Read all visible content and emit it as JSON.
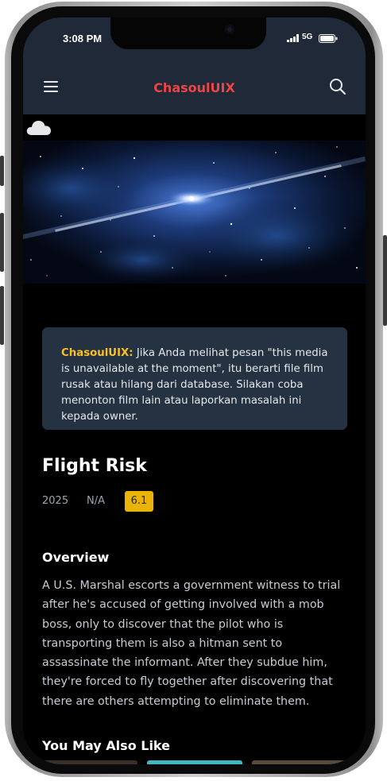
{
  "status_bar": {
    "time": "3:08 PM",
    "network": "5G",
    "icons": [
      "signal-icon",
      "battery-icon"
    ]
  },
  "header": {
    "brand": "ChasoulUIX",
    "brand_color": "#ef4444",
    "icons": [
      "hamburger-menu-icon",
      "search-icon"
    ]
  },
  "notice": {
    "brand": "ChasoulUIX:",
    "message": " Jika Anda melihat pesan \"this media is unavailable at the moment\", itu berarti file film rusak atau hilang dari database. Silakan coba menonton film lain atau laporkan masalah ini kepada owner.",
    "brand_color": "#fbbf24"
  },
  "movie": {
    "title": "Flight Risk",
    "year": "2025",
    "rated": "N/A",
    "rating": "6.1",
    "rating_color": "#eab308"
  },
  "overview": {
    "heading": "Overview",
    "text": "A U.S. Marshal escorts a government witness to trial after he's accused of getting involved with a mob boss, only to discover that the pilot who is transporting them is also a hitman sent to assassinate the informant. After they subdue him, they're forced to fly together after discovering that there are others attempting to eliminate them."
  },
  "recommendations": {
    "heading": "You May Also Like"
  },
  "theme": {
    "bar_color": "#1f2937",
    "notice_bg": "#253241"
  }
}
